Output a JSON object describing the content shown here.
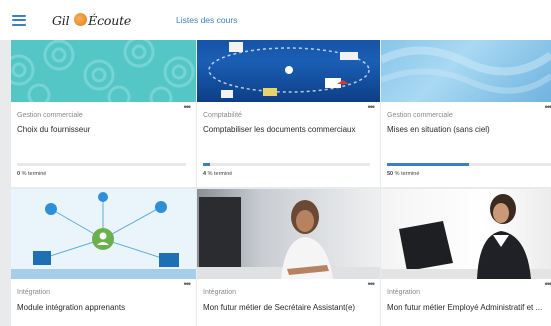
{
  "header": {
    "logo_text_left": "Gil",
    "logo_text_right": "Écoute",
    "nav_link": "Listes des cours"
  },
  "colors": {
    "accent": "#3a7fc4"
  },
  "courses": [
    {
      "category": "Gestion commerciale",
      "title": "Choix du fournisseur",
      "progress_percent": 0,
      "progress_value": "0",
      "progress_suffix": "% terminé",
      "thumbnail": "teal-circles-pattern"
    },
    {
      "category": "Comptabilité",
      "title": "Comptabiliser les documents commerciaux",
      "progress_percent": 4,
      "progress_value": "4",
      "progress_suffix": "% terminé",
      "thumbnail": "documents-flow-illustration"
    },
    {
      "category": "Gestion commerciale",
      "title": "Mises en situation (sans ciel)",
      "progress_percent": 50,
      "progress_value": "50",
      "progress_suffix": "% terminé",
      "thumbnail": "light-blue-wave-pattern"
    },
    {
      "category": "Intégration",
      "title": "Module intégration apprenants",
      "thumbnail": "network-illustration"
    },
    {
      "category": "Intégration",
      "title": "Mon futur métier de Secrétaire Assistant(e)",
      "thumbnail": "woman-writing-photo"
    },
    {
      "category": "Intégration",
      "title": "Mon futur métier Employé Administratif et ...",
      "thumbnail": "woman-on-phone-photo"
    }
  ],
  "icons": {
    "menu": "hamburger-menu-icon",
    "more": "more-options-icon"
  }
}
